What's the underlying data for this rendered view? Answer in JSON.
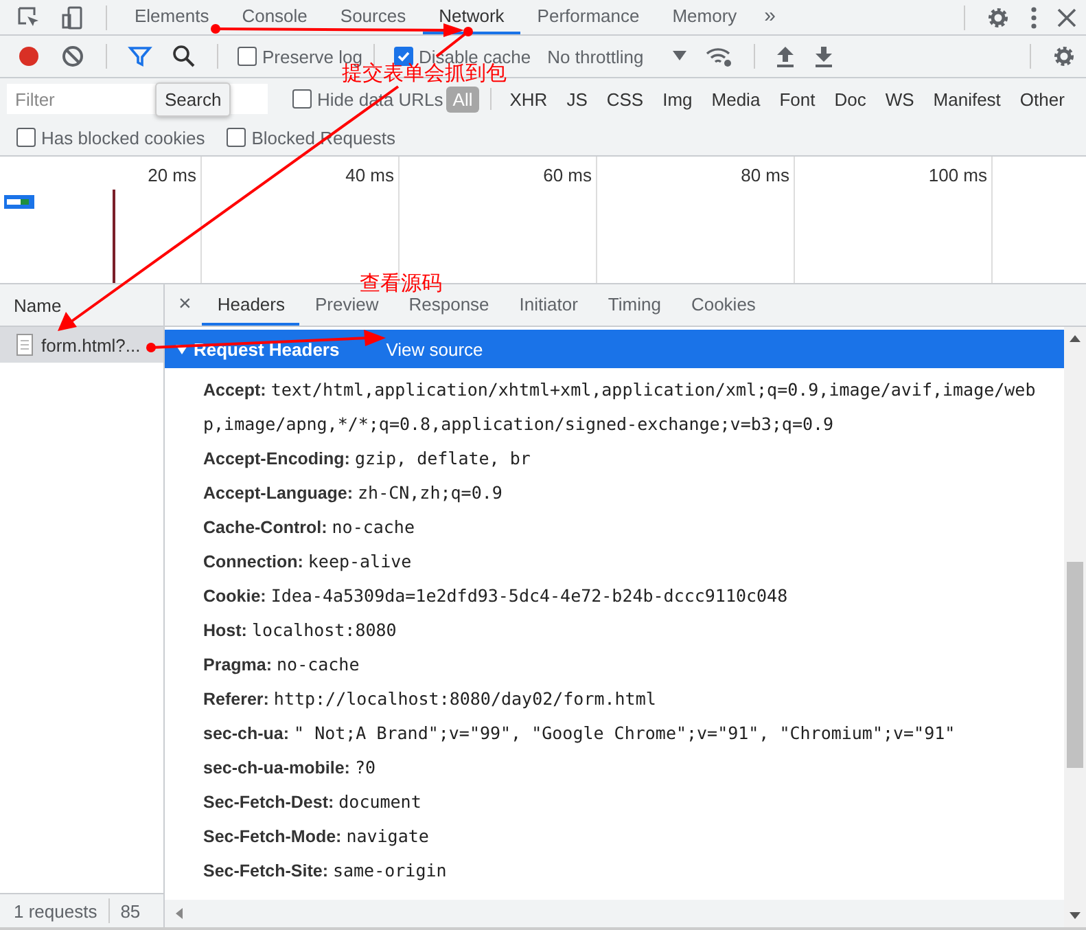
{
  "main_tabs": [
    {
      "label": "Elements",
      "selected": false
    },
    {
      "label": "Console",
      "selected": false
    },
    {
      "label": "Sources",
      "selected": false
    },
    {
      "label": "Network",
      "selected": true
    },
    {
      "label": "Performance",
      "selected": false
    },
    {
      "label": "Memory",
      "selected": false
    }
  ],
  "tabs_overflow": "»",
  "toolbar": {
    "recording": true,
    "filter_active": true,
    "preserve_log": {
      "label": "Preserve log",
      "checked": false
    },
    "disable_cache": {
      "label": "Disable cache",
      "checked": true
    },
    "throttling": "No throttling"
  },
  "filter_bar": {
    "placeholder": "Filter",
    "tooltip": "Search",
    "hide_data_urls": {
      "label": "Hide data URLs",
      "checked": false
    },
    "types": [
      {
        "label": "All",
        "selected": true
      },
      {
        "label": "XHR",
        "selected": false
      },
      {
        "label": "JS",
        "selected": false
      },
      {
        "label": "CSS",
        "selected": false
      },
      {
        "label": "Img",
        "selected": false
      },
      {
        "label": "Media",
        "selected": false
      },
      {
        "label": "Font",
        "selected": false
      },
      {
        "label": "Doc",
        "selected": false
      },
      {
        "label": "WS",
        "selected": false
      },
      {
        "label": "Manifest",
        "selected": false
      },
      {
        "label": "Other",
        "selected": false
      }
    ]
  },
  "blocked_filters": [
    {
      "label": "Has blocked cookies",
      "checked": false
    },
    {
      "label": "Blocked Requests",
      "checked": false
    }
  ],
  "timeline": {
    "ticks": [
      "20 ms",
      "40 ms",
      "60 ms",
      "80 ms",
      "100 ms"
    ]
  },
  "requests": {
    "column": "Name",
    "rows": [
      {
        "name": "form.html?...",
        "selected": true
      }
    ],
    "status": [
      "1 requests",
      "85"
    ]
  },
  "detail_tabs": [
    {
      "label": "Headers",
      "selected": true
    },
    {
      "label": "Preview",
      "selected": false
    },
    {
      "label": "Response",
      "selected": false
    },
    {
      "label": "Initiator",
      "selected": false
    },
    {
      "label": "Timing",
      "selected": false
    },
    {
      "label": "Cookies",
      "selected": false
    }
  ],
  "close_glyph": "×",
  "section": {
    "title": "Request Headers",
    "expanded": true,
    "link": "View source",
    "headers": [
      {
        "name": "Accept:",
        "value": "text/html,application/xhtml+xml,application/xml;q=0.9,image/avif,image/webp,image/apng,*/*;q=0.8,application/signed-exchange;v=b3;q=0.9"
      },
      {
        "name": "Accept-Encoding:",
        "value": "gzip, deflate, br"
      },
      {
        "name": "Accept-Language:",
        "value": "zh-CN,zh;q=0.9"
      },
      {
        "name": "Cache-Control:",
        "value": "no-cache"
      },
      {
        "name": "Connection:",
        "value": "keep-alive"
      },
      {
        "name": "Cookie:",
        "value": "Idea-4a5309da=1e2dfd93-5dc4-4e72-b24b-dccc9110c048"
      },
      {
        "name": "Host:",
        "value": "localhost:8080"
      },
      {
        "name": "Pragma:",
        "value": "no-cache"
      },
      {
        "name": "Referer:",
        "value": "http://localhost:8080/day02/form.html"
      },
      {
        "name": "sec-ch-ua:",
        "value": "\" Not;A Brand\";v=\"99\", \"Google Chrome\";v=\"91\", \"Chromium\";v=\"91\""
      },
      {
        "name": "sec-ch-ua-mobile:",
        "value": "?0"
      },
      {
        "name": "Sec-Fetch-Dest:",
        "value": "document"
      },
      {
        "name": "Sec-Fetch-Mode:",
        "value": "navigate"
      },
      {
        "name": "Sec-Fetch-Site:",
        "value": "same-origin"
      }
    ]
  },
  "annotations": [
    {
      "text": "提交表单会抓到包"
    },
    {
      "text": "查看源码"
    }
  ]
}
